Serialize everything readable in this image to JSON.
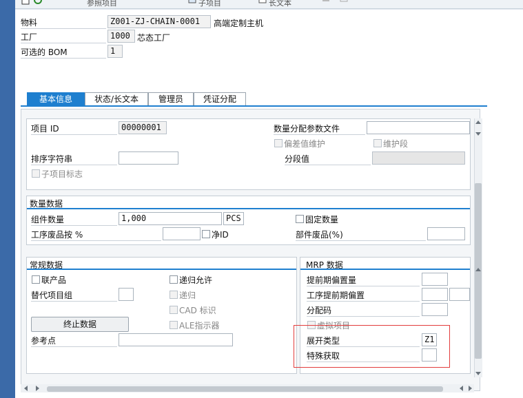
{
  "toolbar": {
    "item1": "参照项目",
    "item2": "子项目",
    "item3": "长文本"
  },
  "header": {
    "material_label": "物料",
    "material_value": "Z001-ZJ-CHAIN-0001",
    "material_desc": "高端定制主机",
    "plant_label": "工厂",
    "plant_value": "1000",
    "plant_desc": "芯态工厂",
    "altbom_label": "可选的 BOM",
    "altbom_value": "1"
  },
  "tabs": [
    {
      "label": "基本信息",
      "active": true
    },
    {
      "label": "状态/长文本",
      "active": false
    },
    {
      "label": "管理员",
      "active": false
    },
    {
      "label": "凭证分配",
      "active": false
    }
  ],
  "general": {
    "item_id_label": "项目 ID",
    "item_id_value": "00000001",
    "qty_dist_label": "数量分配参数文件",
    "qty_dist_value": "",
    "deviation_label": "偏差值维护",
    "maint_seg_label": "维护段",
    "sort_string_label": "排序字符串",
    "sort_string_value": "",
    "seg_value_label": "分段值",
    "seg_value_value": "",
    "subitem_flag_label": "子项目标志"
  },
  "quantity": {
    "title": "数量数据",
    "comp_qty_label": "组件数量",
    "comp_qty_value": "1,000",
    "unit_value": "PCS",
    "fixed_qty_label": "固定数量",
    "op_scrap_label": "工序废品按 %",
    "op_scrap_value": "",
    "net_id_label": "净ID",
    "comp_scrap_label": "部件废品(%)",
    "comp_scrap_value": ""
  },
  "common": {
    "title": "常规数据",
    "coproduct_label": "联产品",
    "recursive_allowed_label": "递归允许",
    "alt_group_label": "替代项目组",
    "alt_group_value": "",
    "recursive_label": "递归",
    "cad_label": "CAD 标识",
    "discontinue_button": "终止数据",
    "ale_label": "ALE指示器",
    "ref_point_label": "参考点",
    "ref_point_value": ""
  },
  "mrp": {
    "title": "MRP 数据",
    "lead_offset_label": "提前期偏置量",
    "lead_offset_value": "",
    "op_lead_offset_label": "工序提前期偏置",
    "op_lead_offset_value1": "",
    "op_lead_offset_value2": "",
    "dist_key_label": "分配码",
    "dist_key_value": "",
    "phantom_label": "虚拟项目",
    "explosion_type_label": "展开类型",
    "explosion_type_value": "Z1",
    "special_proc_label": "特殊获取",
    "special_proc_value": ""
  }
}
